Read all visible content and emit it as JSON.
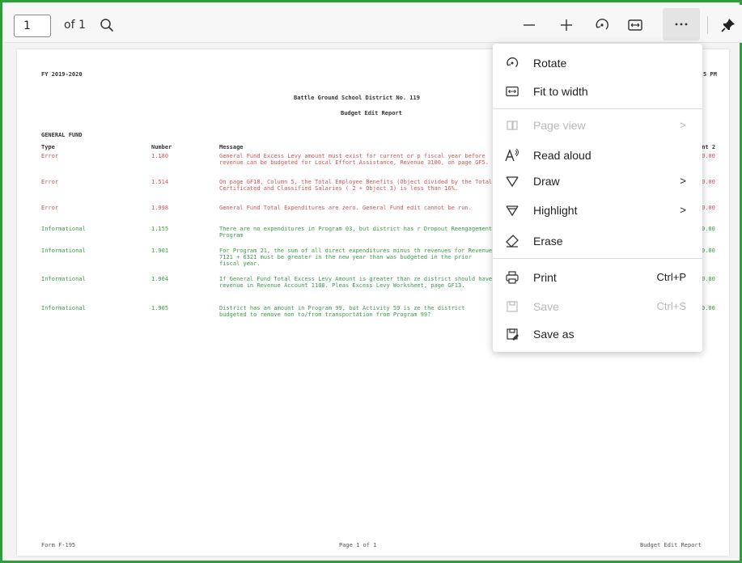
{
  "toolbar": {
    "page_number": "1",
    "page_of": "of 1",
    "icons": [
      "search-icon",
      "zoom-out-icon",
      "zoom-in-icon",
      "rotate-icon",
      "fit-to-width-icon",
      "more-icon",
      "pin-icon"
    ]
  },
  "document": {
    "header_left": "FY 2019-2020",
    "header_right": "5 PM",
    "title": "Battle Ground School District No. 119",
    "subtitle": "Budget Edit Report",
    "fund": "GENERAL FUND",
    "columns": {
      "type": "Type",
      "number": "Number",
      "message": "Message",
      "amount": "unt 2"
    },
    "rows": [
      {
        "type": "Error",
        "number": "1.180",
        "message": "General Fund Excess Levy amount must exist for current or p fiscal year before revenue can be budgeted for Local Effort Assistance, Revenue 3100, on page GF5.",
        "amount": "0.00",
        "kind": "err"
      },
      {
        "type": "Error",
        "number": "1.514",
        "message": "On page GF18, Column 5, the Total Employee Benefits (Object divided by the Total Certificated and Classified Salaries ( 2 + Object 3) is less than 16%.",
        "amount": "0.00",
        "kind": "err"
      },
      {
        "type": "Error",
        "number": "1.998",
        "message": "General Fund Total Expenditures are zero. General Fund edit cannot be run.",
        "amount": "0.00",
        "kind": "err"
      },
      {
        "type": "Informational",
        "number": "1.155",
        "message": "There are no expenditures in Program 03, but district has r Dropout Reengagement Program",
        "amount": "0.00",
        "kind": "info"
      },
      {
        "type": "Informational",
        "number": "1.901",
        "message": "For Program 21, the sum of all direct expenditures minus th revenues for Revenue 7121 + 6321 must be greater in the new year than was budgeted in the prior fiscal year.",
        "amount": "0.00",
        "kind": "info"
      },
      {
        "type": "Informational",
        "number": "1.904",
        "message": "If General Fund Total Excess Levy Amount is greater than ze district should have revenue in Revenue Account 1100. Pleas Excess Levy Worksheet, page GF13.",
        "amount": "0.00",
        "kind": "info"
      },
      {
        "type": "Informational",
        "number": "1.905",
        "message": "District has an amount in Program 99, but Activity 59 is ze the district budgeted to remove non to/from transportation from Program 99?",
        "amount": "0.00",
        "kind": "info"
      }
    ],
    "footer_left": "Form F-195",
    "footer_mid": "Page 1 of 1",
    "footer_right": "Budget Edit Report"
  },
  "menu": {
    "rotate": "Rotate",
    "fit_to_width": "Fit to width",
    "page_view": "Page view",
    "read_aloud": "Read aloud",
    "draw": "Draw",
    "highlight": "Highlight",
    "erase": "Erase",
    "print": "Print",
    "print_shortcut": "Ctrl+P",
    "save": "Save",
    "save_shortcut": "Ctrl+S",
    "save_as": "Save as",
    "submenu_arrow": ">"
  },
  "colors": {
    "frame": "#2e9e3a",
    "error_text": "#d05454",
    "info_text": "#3a9a4a"
  }
}
